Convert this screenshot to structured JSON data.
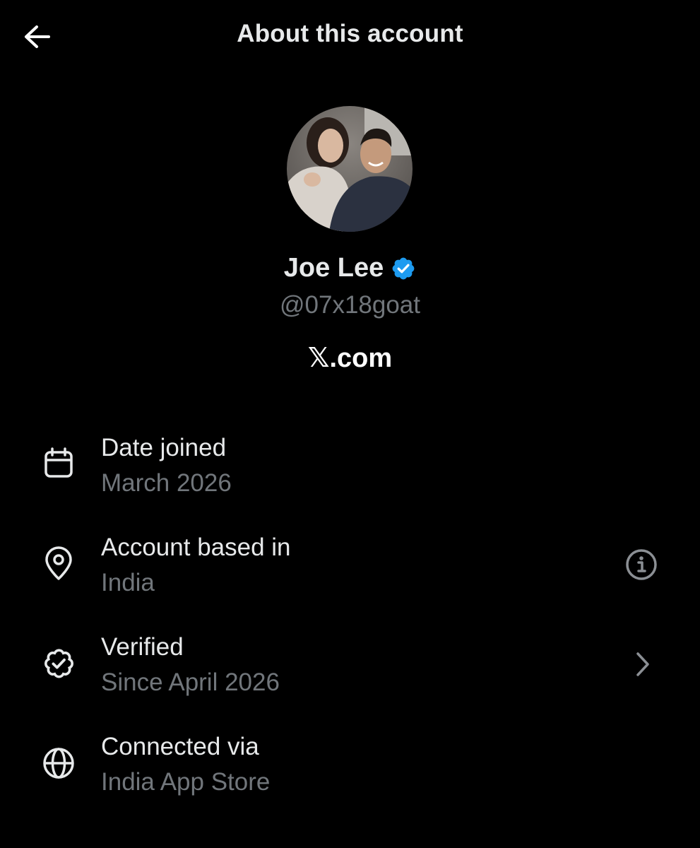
{
  "header": {
    "title": "About this account",
    "back_icon": "arrow-left-icon"
  },
  "profile": {
    "display_name": "Joe Lee",
    "verified_icon": "verified-badge-icon",
    "verified_color": "#1d9bf0",
    "handle": "@07x18goat",
    "avatar": "profile-photo"
  },
  "brand": {
    "label": "𝕏.com"
  },
  "details": [
    {
      "icon": "calendar-icon",
      "label": "Date joined",
      "value": "March 2026",
      "trailing": null
    },
    {
      "icon": "location-pin-icon",
      "label": "Account based in",
      "value": "India",
      "trailing": "info-icon"
    },
    {
      "icon": "verified-outline-icon",
      "label": "Verified",
      "value": "Since April 2026",
      "trailing": "chevron-right-icon"
    },
    {
      "icon": "globe-icon",
      "label": "Connected via",
      "value": "India App Store",
      "trailing": null
    }
  ],
  "colors": {
    "background": "#000000",
    "primary_text": "#e7e9ea",
    "secondary_text": "#71767b",
    "accent": "#1d9bf0"
  }
}
